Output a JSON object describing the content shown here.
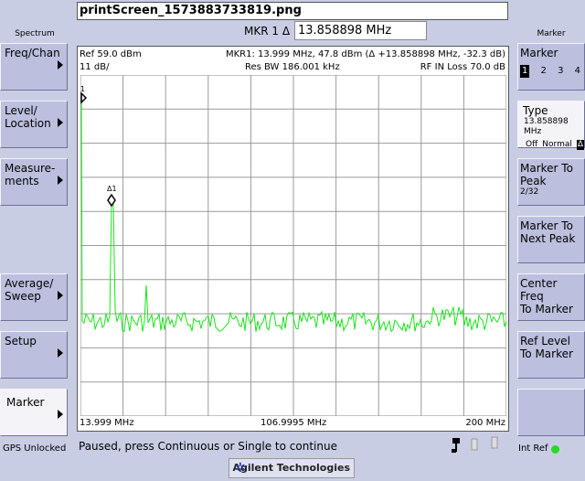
{
  "window": {
    "title": "printScreen_1573883733819.png"
  },
  "left_panel": {
    "header": "Spectrum",
    "buttons": [
      {
        "label_lines": [
          "Freq/Chan"
        ],
        "arrow": true,
        "active": false
      },
      {
        "label_lines": [
          "Level/",
          "Location"
        ],
        "arrow": true,
        "active": false
      },
      {
        "label_lines": [
          "Measure-",
          "ments"
        ],
        "arrow": true,
        "active": false
      },
      {
        "label_lines": [
          "Average/",
          "Sweep"
        ],
        "arrow": true,
        "active": false
      },
      {
        "label_lines": [
          "Setup"
        ],
        "arrow": true,
        "active": false
      },
      {
        "label_lines": [
          "Marker"
        ],
        "arrow": true,
        "active": true
      }
    ],
    "footer": "GPS Unlocked"
  },
  "marker_bar": {
    "label": "MKR 1 Δ",
    "value": "13.858898 MHz"
  },
  "graph": {
    "ref": "Ref 59.0 dBm",
    "scale": "11 dB/",
    "mkr_readout": "MKR1: 13.999 MHz, 47.8 dBm (Δ +13.858898 MHz, -32.3 dB)",
    "res_bw": "Res BW 186.001 kHz",
    "rf_in_loss": "RF IN Loss 70.0 dB",
    "x_start": "13.999 MHz",
    "x_center": "106.9995 MHz",
    "x_stop": "200 MHz",
    "marker_ref_label": "1",
    "marker_delta_label": "Δ1",
    "trace_color": "#19e619"
  },
  "right_panel": {
    "header": "Marker",
    "marker_select": {
      "title": "Marker",
      "options": [
        "1",
        "2",
        "3",
        "4"
      ],
      "selected": "1"
    },
    "type": {
      "title": "Type",
      "value": "13.858898 MHz",
      "options": [
        "Off",
        "Normal",
        "Δ"
      ],
      "selected": "Δ"
    },
    "buttons": [
      {
        "label_lines": [
          "Marker To",
          "Peak"
        ],
        "sub": "2/32"
      },
      {
        "label_lines": [
          "Marker To",
          "Next Peak"
        ],
        "sub": ""
      },
      {
        "label_lines": [
          "Center Freq",
          "To Marker"
        ],
        "sub": ""
      },
      {
        "label_lines": [
          "Ref Level",
          "To Marker"
        ],
        "sub": ""
      }
    ],
    "footer": "Int Ref",
    "int_ref_color": "#22dd22"
  },
  "status": {
    "message": "Paused, press Continuous or Single to continue"
  },
  "logo": {
    "text": "Agilent Technologies"
  }
}
